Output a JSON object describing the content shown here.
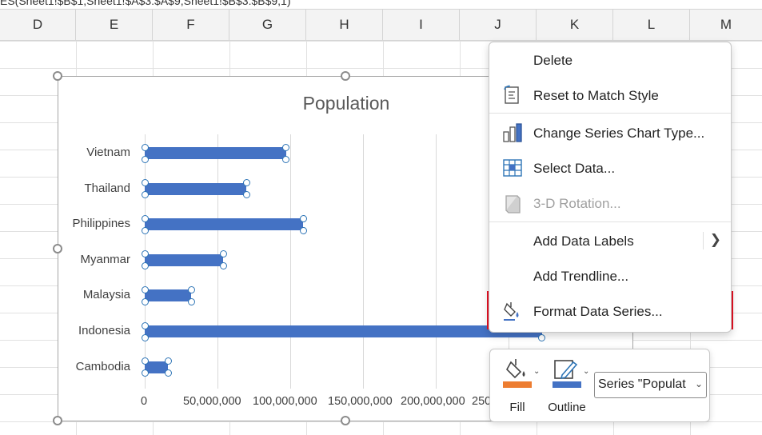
{
  "formula_bar": {
    "text": "ES(Sheet1!$B$1,Sheet1!$A$3:$A$9,Sheet1!$B$3:$B$9,1)"
  },
  "columns": [
    "D",
    "E",
    "F",
    "G",
    "H",
    "I",
    "J",
    "K",
    "L",
    "M"
  ],
  "chart": {
    "title": "Population",
    "x_tick_labels": [
      "0",
      "50,000,000",
      "100,000,000",
      "150,000,000",
      "200,000,000",
      "250"
    ]
  },
  "chart_data": {
    "type": "bar",
    "orientation": "horizontal",
    "title": "Population",
    "categories": [
      "Vietnam",
      "Thailand",
      "Philippines",
      "Myanmar",
      "Malaysia",
      "Indonesia",
      "Cambodia"
    ],
    "values": [
      97000000,
      70000000,
      109000000,
      54000000,
      32000000,
      273000000,
      16000000
    ],
    "xlim": [
      0,
      250000000
    ],
    "grid": true,
    "legend": "none",
    "bar_color": "#4472c4"
  },
  "context_menu": {
    "items": [
      {
        "label": "Delete",
        "icon": "delete-icon",
        "disabled": false
      },
      {
        "label": "Reset to Match Style",
        "icon": "reset-style-icon",
        "disabled": false
      },
      {
        "label": "Change Series Chart Type...",
        "icon": "chart-type-icon",
        "disabled": false
      },
      {
        "label": "Select Data...",
        "icon": "select-data-icon",
        "disabled": false
      },
      {
        "label": "3-D Rotation...",
        "icon": "rotation-3d-icon",
        "disabled": true
      },
      {
        "label": "Add Data Labels",
        "icon": "",
        "disabled": false,
        "submenu": true
      },
      {
        "label": "Add Trendline...",
        "icon": "",
        "disabled": false
      },
      {
        "label": "Format Data Series...",
        "icon": "format-series-icon",
        "disabled": false,
        "highlighted": true
      }
    ]
  },
  "mini_toolbar": {
    "fill_label": "Fill",
    "outline_label": "Outline",
    "series_selector_value": "Series \"Populat",
    "fill_color": "#ed7d31",
    "outline_color": "#4472c4"
  },
  "colors": {
    "accent": "#4472c4",
    "highlight_border": "#e81123"
  }
}
